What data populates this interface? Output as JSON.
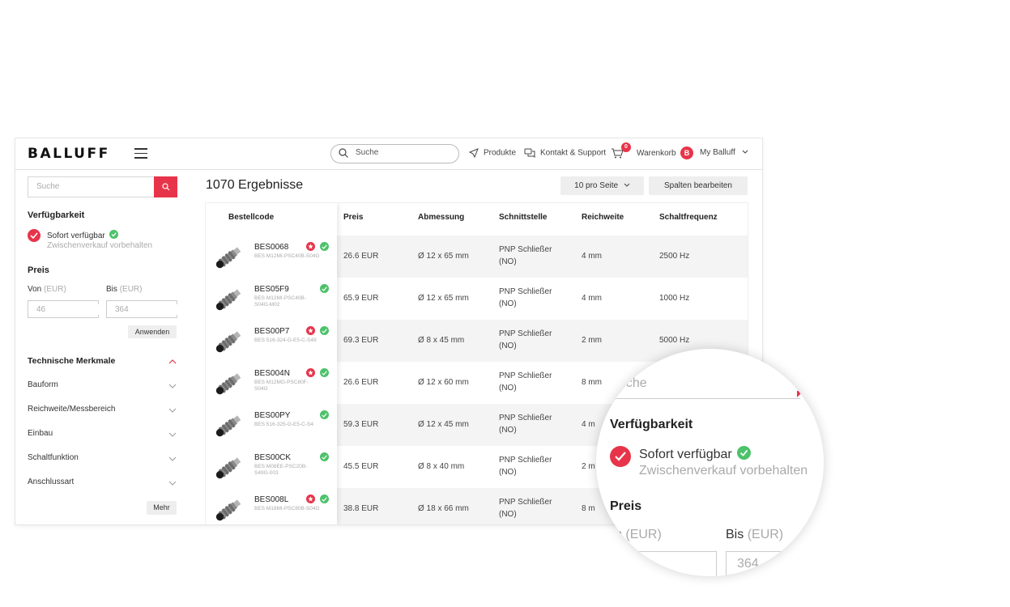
{
  "header": {
    "logo": "BALLUFF",
    "search_placeholder": "Suche",
    "nav_products": "Produkte",
    "nav_contact": "Kontakt & Support",
    "cart_count": "0",
    "cart_label": "Warenkorb",
    "user_initial": "B",
    "user_label": "My Balluff"
  },
  "sidebar": {
    "search_placeholder": "Suche",
    "availability_title": "Verfügbarkeit",
    "availability_option": "Sofort verfügbar",
    "availability_note": "Zwischenverkauf vorbehalten",
    "price_title": "Preis",
    "from_label": "Von",
    "to_label": "Bis",
    "currency": "(EUR)",
    "from_placeholder": "46",
    "to_placeholder": "364",
    "apply_label": "Anwenden",
    "tech_title": "Technische Merkmale",
    "facets": [
      "Bauform",
      "Reichweite/Messbereich",
      "Einbau",
      "Schaltfunktion",
      "Anschlussart"
    ],
    "more_label": "Mehr"
  },
  "main": {
    "results_count": "1070 Ergebnisse",
    "per_page": "10 pro Seite",
    "edit_columns": "Spalten bearbeiten",
    "columns": [
      "Bestellcode",
      "Preis",
      "Abmessung",
      "Schnittstelle",
      "Reichweite",
      "Schaltfrequenz"
    ],
    "rows": [
      {
        "code": "BES0068",
        "sub": "BES M12MI-PSC40B-S04G",
        "price": "26.6 EUR",
        "dim": "Ø 12 x 65 mm",
        "iface1": "PNP Schließer",
        "iface2": "(NO)",
        "range": "4 mm",
        "freq": "2500 Hz",
        "star": true
      },
      {
        "code": "BES05F9",
        "sub": "BES M12MI-PSC40B-S04G-M02",
        "price": "65.9 EUR",
        "dim": "Ø 12 x 65 mm",
        "iface1": "PNP Schließer",
        "iface2": "(NO)",
        "range": "4 mm",
        "freq": "1000 Hz",
        "star": false
      },
      {
        "code": "BES00P7",
        "sub": "BES 516-324-G-E5-C-S49",
        "price": "69.3 EUR",
        "dim": "Ø 8 x 45 mm",
        "iface1": "PNP Schließer",
        "iface2": "(NO)",
        "range": "2 mm",
        "freq": "5000 Hz",
        "star": true
      },
      {
        "code": "BES004N",
        "sub": "BES M12MG-PSC80F-S04G",
        "price": "26.6 EUR",
        "dim": "Ø 12 x 60 mm",
        "iface1": "PNP Schließer",
        "iface2": "(NO)",
        "range": "8 mm",
        "freq": "",
        "star": true
      },
      {
        "code": "BES00PY",
        "sub": "BES 516-325-G-E5-C-S4",
        "price": "59.3 EUR",
        "dim": "Ø 12 x 45 mm",
        "iface1": "PNP Schließer",
        "iface2": "(NO)",
        "range": "4 m",
        "freq": "",
        "star": false
      },
      {
        "code": "BES00CK",
        "sub": "BES M08EE-PSC20B-S49G-003",
        "price": "45.5 EUR",
        "dim": "Ø 8 x 40 mm",
        "iface1": "PNP Schließer",
        "iface2": "(NO)",
        "range": "2 m",
        "freq": "",
        "star": false
      },
      {
        "code": "BES008L",
        "sub": "BES M18MI-PSC80B-S04G",
        "price": "38.8 EUR",
        "dim": "Ø 18 x 66 mm",
        "iface1": "PNP Schließer",
        "iface2": "(NO)",
        "range": "8 m",
        "freq": "",
        "star": true
      }
    ]
  },
  "magnifier": {
    "search_fragment": "uche",
    "availability_title": "Verfügbarkeit",
    "availability_option": "Sofort verfügbar",
    "availability_note": "Zwischenverkauf vorbehalten",
    "price_title": "Preis",
    "from_fragment": "n",
    "currency": "(EUR)",
    "to_label": "Bis",
    "to_placeholder_fragment": "364"
  },
  "colors": {
    "accent": "#e8344a",
    "available": "#4cc26a"
  }
}
